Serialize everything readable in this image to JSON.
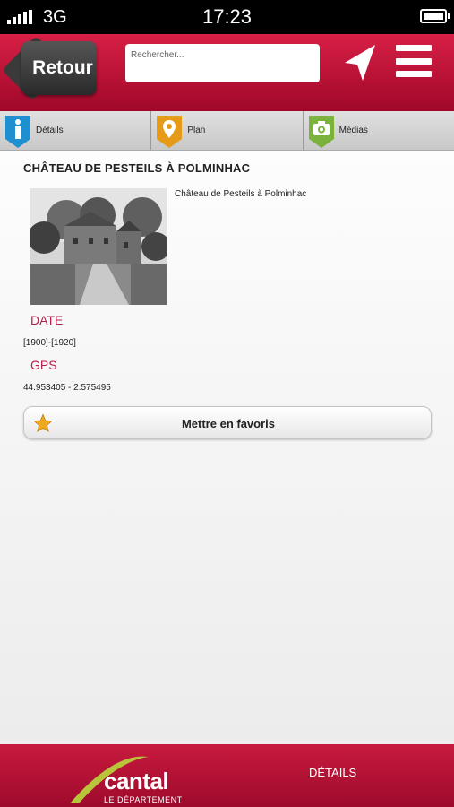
{
  "status_bar": {
    "carrier": "3G",
    "time": "17:23"
  },
  "header": {
    "back_label": "Retour",
    "search_placeholder": "Rechercher..."
  },
  "tabs": [
    {
      "label": "Détails",
      "icon": "info-icon",
      "color": "#1f8fd0"
    },
    {
      "label": "Plan",
      "icon": "map-pin-icon",
      "color": "#e69a1a"
    },
    {
      "label": "Médias",
      "icon": "camera-icon",
      "color": "#7bb23b"
    }
  ],
  "detail": {
    "title": "CHÂTEAU DE PESTEILS À POLMINHAC",
    "caption": "Château de Pesteils à Polminhac",
    "date_label": "DATE",
    "date_value": "[1900]-[1920]",
    "gps_label": "GPS",
    "gps_value": "44.953405 - 2.575495",
    "favorite_label": "Mettre en favoris"
  },
  "footer": {
    "logo_name": "cantal",
    "logo_subtitle": "LE DÉPARTEMENT",
    "details_label": "DÉTAILS"
  },
  "colors": {
    "brand": "#c81a3e",
    "accent_text": "#b4214a",
    "star": "#f0a81e"
  }
}
